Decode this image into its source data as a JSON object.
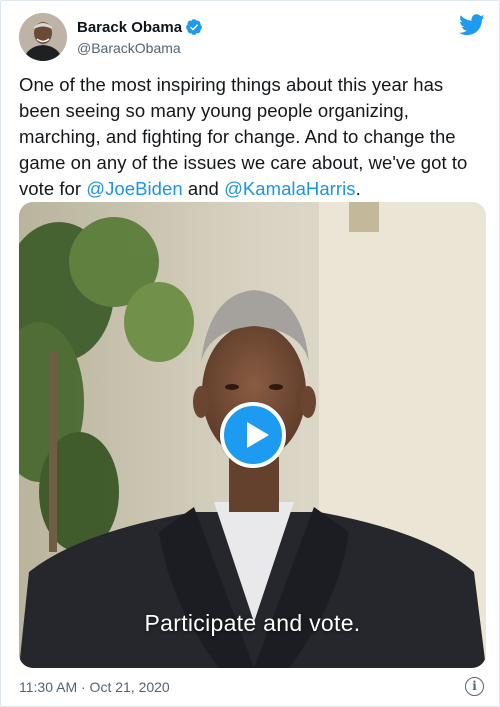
{
  "author": {
    "name": "Barack Obama",
    "handle": "@BarackObama",
    "verified": true
  },
  "tweet": {
    "text_1": "One of the most inspiring things about this year has been seeing so many young people organizing, marching, and fighting for change. And to change the game on any of the issues we care about, we've got to vote for ",
    "mention_1": "@JoeBiden",
    "text_2": " and ",
    "mention_2": "@KamalaHarris",
    "text_3": "."
  },
  "media": {
    "caption": "Participate and vote."
  },
  "footer": {
    "timestamp": "11:30 AM · Oct 21, 2020"
  },
  "colors": {
    "brand_blue": "#1d9bf0",
    "mention_blue": "#1b95e0",
    "muted_text": "#536471"
  },
  "icons": [
    "verified-badge-icon",
    "twitter-bird-icon",
    "play-icon",
    "info-icon"
  ]
}
